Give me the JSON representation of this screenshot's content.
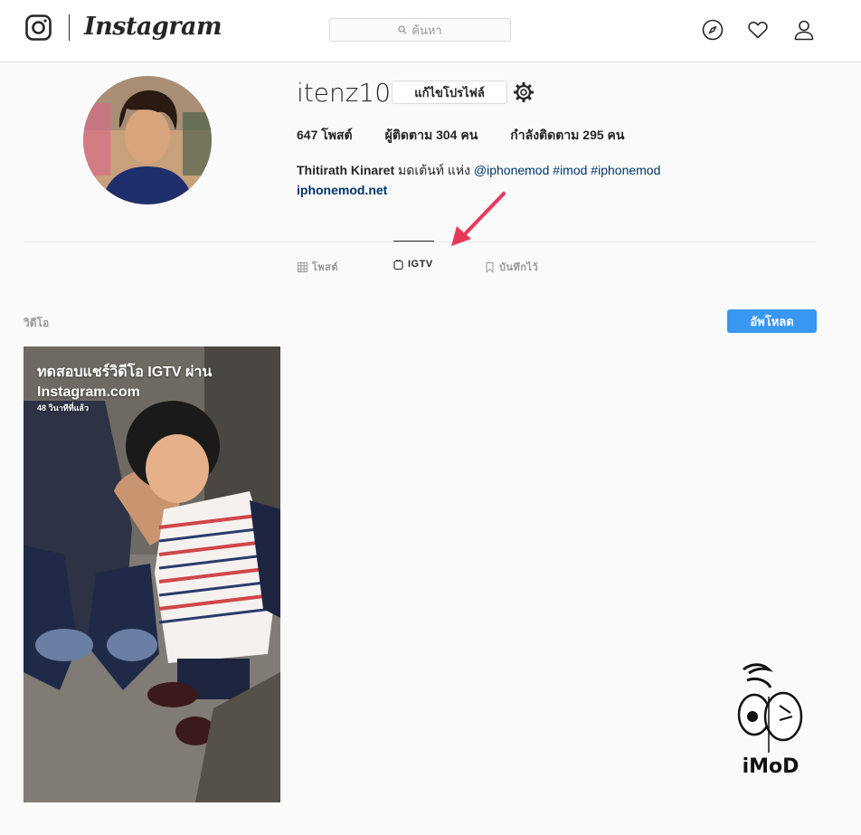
{
  "header": {
    "wordmark": "Instagram",
    "search_placeholder": "ค้นหา",
    "icons": [
      "instagram-glyph-icon",
      "search-icon",
      "compass-icon",
      "heart-icon",
      "profile-icon"
    ]
  },
  "profile": {
    "username": "itenz10",
    "edit_label": "แก้ไขโปรไฟล์",
    "stats": {
      "posts": "647 โพสต์",
      "followers": "ผู้ติดตาม 304 คน",
      "following": "กำลังติดตาม 295 คน"
    },
    "bio": {
      "name": "Thitirath Kinaret",
      "text": " มดเต้นท์ แห่ง ",
      "mention": "@iphonemod",
      "hashtag1": " #imod",
      "hashtag2": " #iphonemod",
      "website": "iphonemod.net"
    }
  },
  "tabs": {
    "posts": "โพสต์",
    "igtv": "IGTV",
    "saved": "บันทึกไว้"
  },
  "videos": {
    "section_label": "วิดีโอ",
    "upload_label": "อัพโหลด",
    "items": [
      {
        "title": "ทดสอบแชร์วิดีโอ IGTV ผ่าน Instagram.com",
        "time": "48 วินาทีที่แล้ว"
      }
    ]
  },
  "watermark": {
    "text": "iMoD"
  },
  "colors": {
    "accent": "#3897f0",
    "link": "#003569",
    "arrow": "#e8385a"
  }
}
